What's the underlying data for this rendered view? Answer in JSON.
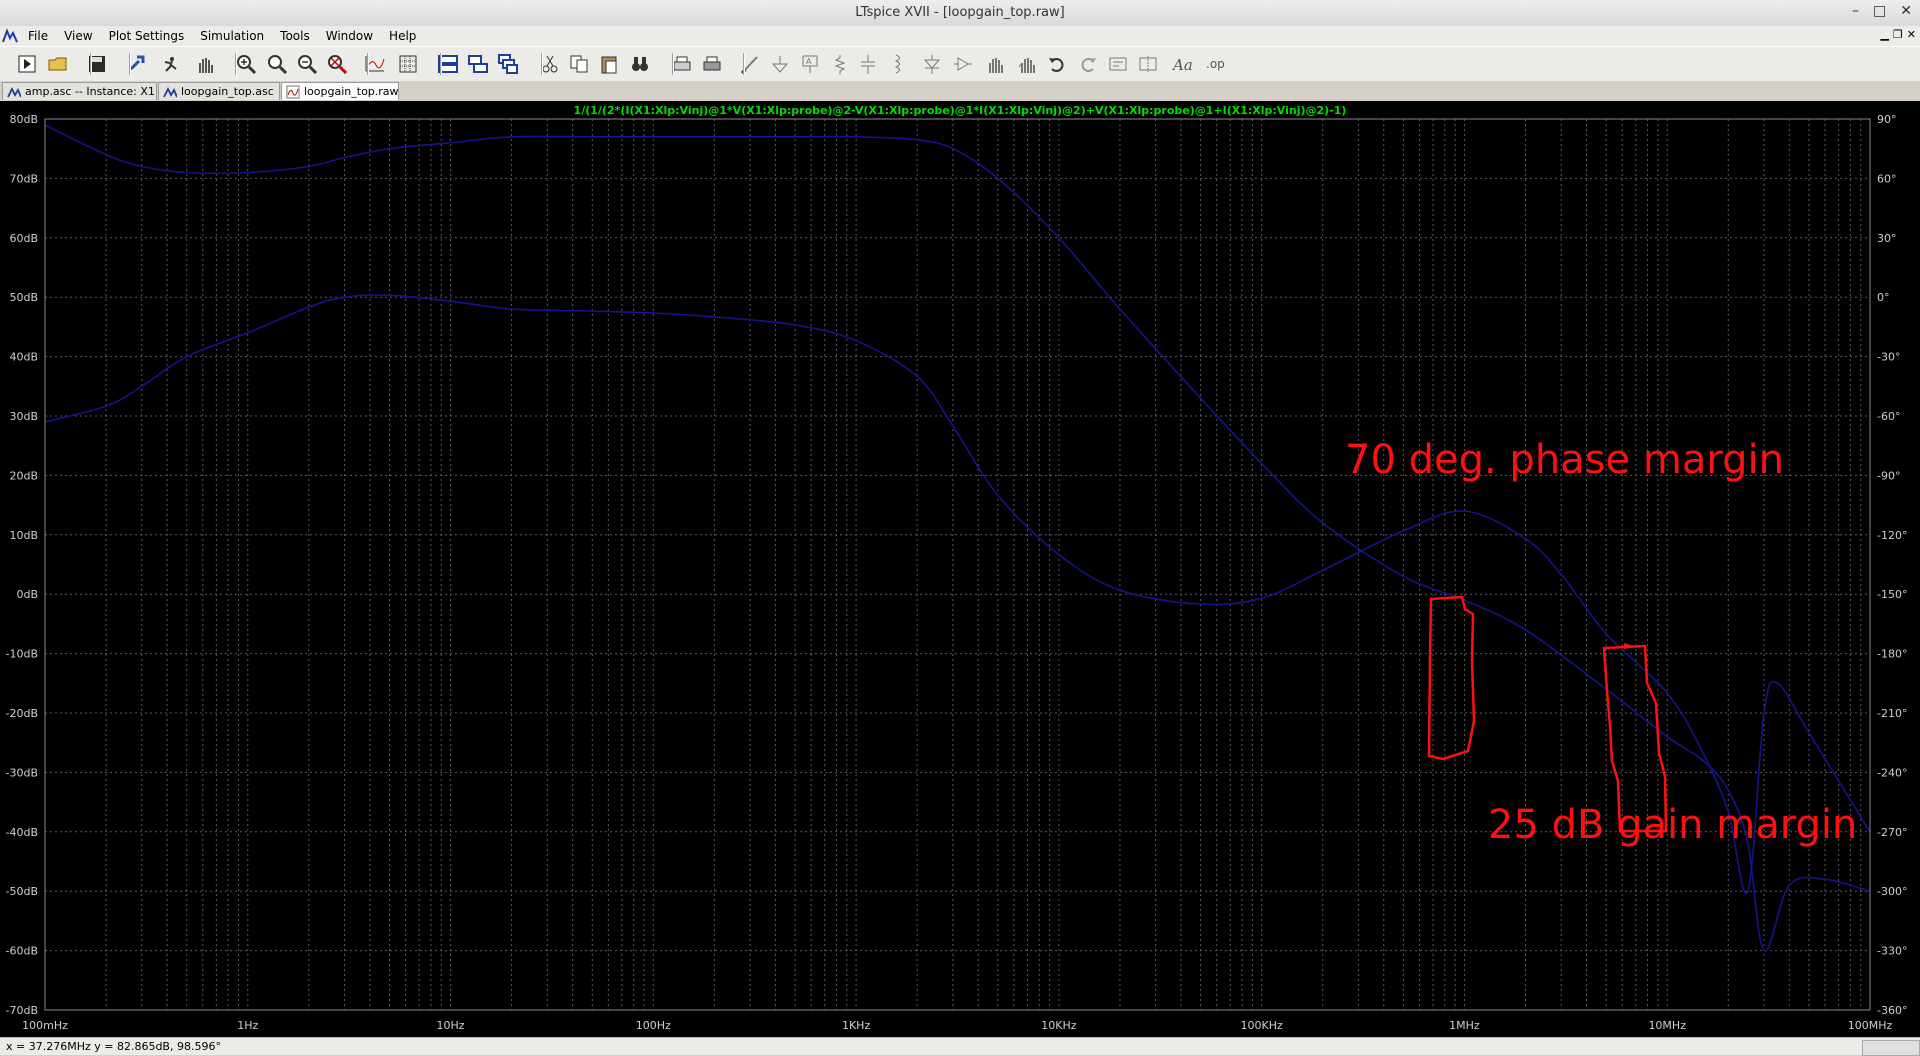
{
  "window": {
    "title": "LTspice XVII - [loopgain_top.raw]"
  },
  "menu": [
    "File",
    "View",
    "Plot Settings",
    "Simulation",
    "Tools",
    "Window",
    "Help"
  ],
  "toolbar": [
    "run-icon",
    "open-icon",
    "save-icon",
    "control-panel-icon",
    "halt-icon",
    "pan-icon",
    "zoom-in-icon",
    "zoom-area-icon",
    "zoom-out-icon",
    "zoom-fit-icon",
    "autorange-icon",
    "grid-icon",
    "tile-horizontal-icon",
    "tile-vertical-icon",
    "cascade-icon",
    "cut-icon",
    "copy-icon",
    "paste-icon",
    "find-icon",
    "print-icon",
    "print-preview-icon",
    "wire-icon",
    "ground-icon",
    "label-icon",
    "resistor-icon",
    "capacitor-icon",
    "inductor-icon",
    "diode-icon",
    "component-icon",
    "move-icon",
    "drag-icon",
    "undo-icon",
    "redo-icon",
    "rotate-icon",
    "mirror-icon",
    "text-icon",
    "spice-directive-icon"
  ],
  "tabs": [
    {
      "label": "amp.asc -- Instance: X1",
      "icon": "schematic-icon"
    },
    {
      "label": "loopgain_top.asc",
      "icon": "schematic-icon"
    },
    {
      "label": "loopgain_top.raw",
      "icon": "waveform-icon"
    }
  ],
  "plot": {
    "trace_expression": "1/(1/(2*(I(X1:Xlp:Vinj)@1*V(X1:Xlp:probe)@2-V(X1:Xlp:probe)@1*I(X1:Xlp:Vinj)@2)+V(X1:Xlp:probe)@1+I(X1:Xlp:Vinj)@2)-1)",
    "trace_color": "#00dd00",
    "background": "#000000",
    "grid_color": "#5a5a5a",
    "curve_color": "#14148c",
    "annotation_color": "#ff1010",
    "annotations": [
      "70 deg. phase margin",
      "25 dB gain margin"
    ]
  },
  "status": {
    "cursor": "x = 37.276MHz   y = 82.865dB, 98.596°"
  },
  "chart_data": {
    "type": "line",
    "xscale": "log",
    "xlim": [
      "100mHz",
      "100MHz"
    ],
    "x_ticks": [
      "100mHz",
      "1Hz",
      "10Hz",
      "100Hz",
      "1KHz",
      "10KHz",
      "100KHz",
      "1MHz",
      "10MHz",
      "100MHz"
    ],
    "y_left_ticks": [
      "80dB",
      "70dB",
      "60dB",
      "50dB",
      "40dB",
      "30dB",
      "20dB",
      "10dB",
      "0dB",
      "-10dB",
      "-20dB",
      "-30dB",
      "-40dB",
      "-50dB",
      "-60dB",
      "-70dB"
    ],
    "y_right_ticks": [
      "90°",
      "60°",
      "30°",
      "0°",
      "-30°",
      "-60°",
      "-90°",
      "-120°",
      "-150°",
      "-180°",
      "-210°",
      "-240°",
      "-270°",
      "-300°",
      "-330°",
      "-360°"
    ],
    "ylim_left": [
      -70,
      80
    ],
    "ylim_right": [
      -360,
      90
    ],
    "grid": true,
    "series": [
      {
        "axis": "left",
        "x": [
          0.1,
          0.2,
          0.3,
          0.5,
          1,
          2,
          3,
          5,
          10,
          20,
          50,
          100,
          200,
          500,
          1000,
          2000,
          3000,
          5000,
          10000,
          20000,
          50000,
          100000,
          200000,
          500000,
          1000000,
          2000000,
          5000000,
          10000000,
          15000000,
          20000000,
          25000000,
          30000000,
          40000000,
          60000000,
          100000000
        ],
        "y": [
          79,
          74,
          72,
          71,
          71,
          72,
          73.5,
          75,
          76,
          77,
          77,
          77,
          77,
          77,
          77,
          76.5,
          75,
          70,
          60,
          48,
          33,
          22,
          12,
          3,
          -1,
          -6,
          -16,
          -24,
          -28,
          -33,
          -42,
          -60,
          -49,
          -48,
          -50
        ]
      },
      {
        "axis": "right",
        "x": [
          0.1,
          0.2,
          0.3,
          0.5,
          1,
          2,
          3,
          5,
          10,
          20,
          50,
          100,
          200,
          500,
          1000,
          2000,
          3000,
          5000,
          10000,
          20000,
          50000,
          100000,
          200000,
          500000,
          1000000,
          2000000,
          3000000,
          5000000,
          10000000,
          15000000,
          20000000,
          25000000,
          30000000,
          35000000,
          50000000,
          100000000
        ],
        "y": [
          -63,
          -55,
          -45,
          -30,
          -18,
          -5,
          0,
          1,
          -2,
          -6,
          -7,
          -8,
          -10,
          -14,
          -22,
          -40,
          -65,
          -100,
          -130,
          -148,
          -155,
          -152,
          -138,
          -118,
          -108,
          -122,
          -140,
          -170,
          -200,
          -230,
          -260,
          -300,
          -210,
          -195,
          -220,
          -270
        ]
      }
    ]
  }
}
